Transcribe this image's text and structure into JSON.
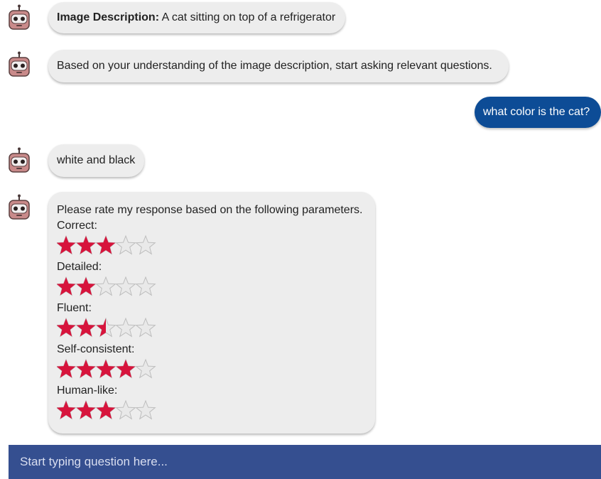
{
  "messages": {
    "m1": {
      "strong": "Image Description:",
      "text": " A cat sitting on top of a refrigerator"
    },
    "m2": {
      "text": "Based on your understanding of the image description, start asking relevant questions."
    },
    "user1": {
      "text": "what color is the cat?"
    },
    "m3": {
      "text": "white and black"
    },
    "rating": {
      "prompt": "Please rate my response based on the following parameters.",
      "params": [
        {
          "label": "Correct:",
          "stars": 3,
          "max": 5
        },
        {
          "label": "Detailed:",
          "stars": 2,
          "max": 5
        },
        {
          "label": "Fluent:",
          "stars": 2.5,
          "max": 5
        },
        {
          "label": "Self-consistent:",
          "stars": 4,
          "max": 5
        },
        {
          "label": "Human-like:",
          "stars": 3,
          "max": 5
        }
      ]
    }
  },
  "input": {
    "placeholder": "Start typing question here..."
  },
  "colors": {
    "star_filled": "#d7143c",
    "star_empty_fill": "#e9e9e9",
    "star_empty_stroke": "#bdbdbd",
    "bot_bubble": "#ededed",
    "user_bubble": "#0d4c96",
    "input_bar": "#354f90"
  },
  "icons": {
    "bot_avatar": "robot-icon",
    "star": "star-icon"
  }
}
